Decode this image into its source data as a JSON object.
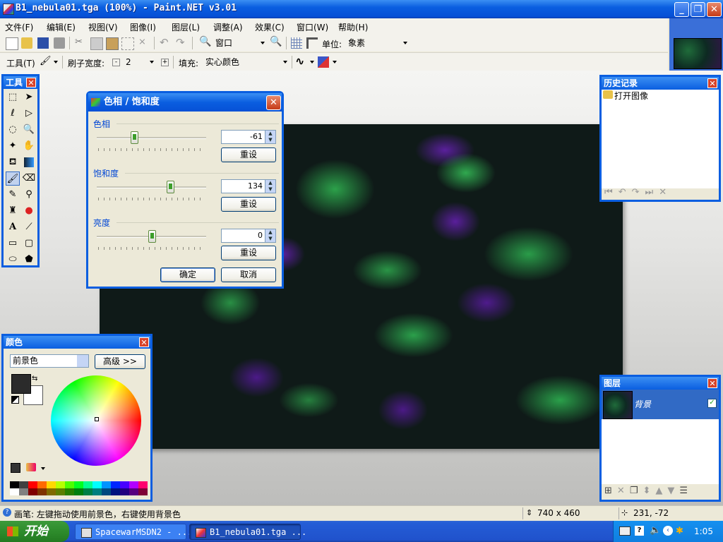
{
  "window": {
    "title": "B1_nebula01.tga (100%) - Paint.NET v3.01"
  },
  "menu": [
    "文件(F)",
    "编辑(E)",
    "视图(V)",
    "图像(I)",
    "图层(L)",
    "调整(A)",
    "效果(C)",
    "窗口(W)",
    "帮助(H)"
  ],
  "toolbar1": {
    "zoom_value": "窗口",
    "units_label": "单位:",
    "units_value": "象素"
  },
  "toolbar2": {
    "tool_label": "工具(T)",
    "brush_width_label": "刷子宽度:",
    "brush_width_value": "2",
    "fill_label": "填充:",
    "fill_value": "实心颜色"
  },
  "tools_palette": {
    "title": "工具"
  },
  "dialog": {
    "title": "色相 / 饱和度",
    "hue": {
      "label": "色相",
      "value": "-61",
      "reset": "重设",
      "level": 0.34
    },
    "saturation": {
      "label": "饱和度",
      "value": "134",
      "reset": "重设",
      "level": 0.67
    },
    "lightness": {
      "label": "亮度",
      "value": "0",
      "reset": "重设",
      "level": 0.5
    },
    "ok": "确定",
    "cancel": "取消"
  },
  "history": {
    "title": "历史记录",
    "items": [
      "打开图像"
    ]
  },
  "colors": {
    "title": "颜色",
    "select_value": "前景色",
    "advanced_button": "高级 >>",
    "primary": "#2b2b2b",
    "secondary": "#ffffff"
  },
  "layers": {
    "title": "图层",
    "layer_name": "背景"
  },
  "status": {
    "hint": "画笔: 左键拖动使用前景色，右键使用背景色",
    "image_size": "740 x 460",
    "cursor_pos": "231, -72"
  },
  "taskbar": {
    "start": "开始",
    "tasks": [
      "SpacewarMSDN2 - ...",
      "B1_nebula01.tga ..."
    ],
    "clock": "1:05"
  }
}
